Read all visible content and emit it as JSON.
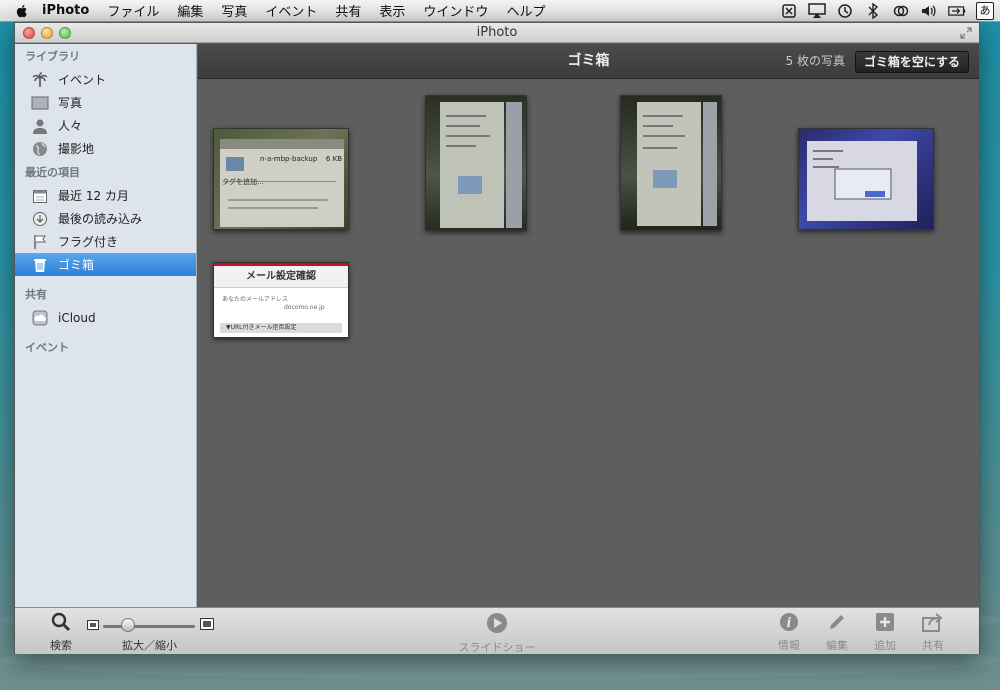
{
  "menubar": {
    "app_name": "iPhoto",
    "items": [
      "ファイル",
      "編集",
      "写真",
      "イベント",
      "共有",
      "表示",
      "ウインドウ",
      "ヘルプ"
    ],
    "input_mode": "あ"
  },
  "window": {
    "title": "iPhoto"
  },
  "sidebar": {
    "library_header": "ライブラリ",
    "library_items": [
      {
        "label": "イベント",
        "icon": "palm-tree-icon"
      },
      {
        "label": "写真",
        "icon": "photo-icon"
      },
      {
        "label": "人々",
        "icon": "person-icon"
      },
      {
        "label": "撮影地",
        "icon": "globe-icon"
      }
    ],
    "recent_header": "最近の項目",
    "recent_items": [
      {
        "label": "最近 12 カ月",
        "icon": "calendar-icon"
      },
      {
        "label": "最後の読み込み",
        "icon": "import-icon"
      },
      {
        "label": "フラグ付き",
        "icon": "flag-icon"
      },
      {
        "label": "ゴミ箱",
        "icon": "trash-icon",
        "selected": true
      }
    ],
    "shared_header": "共有",
    "shared_items": [
      {
        "label": "iCloud",
        "icon": "icloud-icon"
      }
    ],
    "events_header": "イベント"
  },
  "content": {
    "title": "ゴミ箱",
    "photo_count": "5 枚の写真",
    "empty_trash_label": "ゴミ箱を空にする"
  },
  "thumbnails": [
    {
      "kind": "screen-photo",
      "caption": "n-a-mbp-backup",
      "text1": "タグを追加...",
      "size": "6 KB"
    },
    {
      "kind": "screen-photo-tall"
    },
    {
      "kind": "screen-photo-tall"
    },
    {
      "kind": "screen-photo-wide"
    },
    {
      "kind": "screenshot",
      "title": "メール設定確認",
      "line1": "あなたのメールアドレス",
      "line2": "docomo.ne.jp",
      "footer": "▼URL付きメール拒否設定"
    }
  ],
  "toolbar": {
    "search": "検索",
    "zoom": "拡大／縮小",
    "slideshow": "スライドショー",
    "info": "情報",
    "edit": "編集",
    "add": "追加",
    "share": "共有"
  },
  "colors": {
    "selection": "#3d8ee0",
    "sidebar_bg": "#dde4ec",
    "grid_bg": "#5e5e5e"
  }
}
